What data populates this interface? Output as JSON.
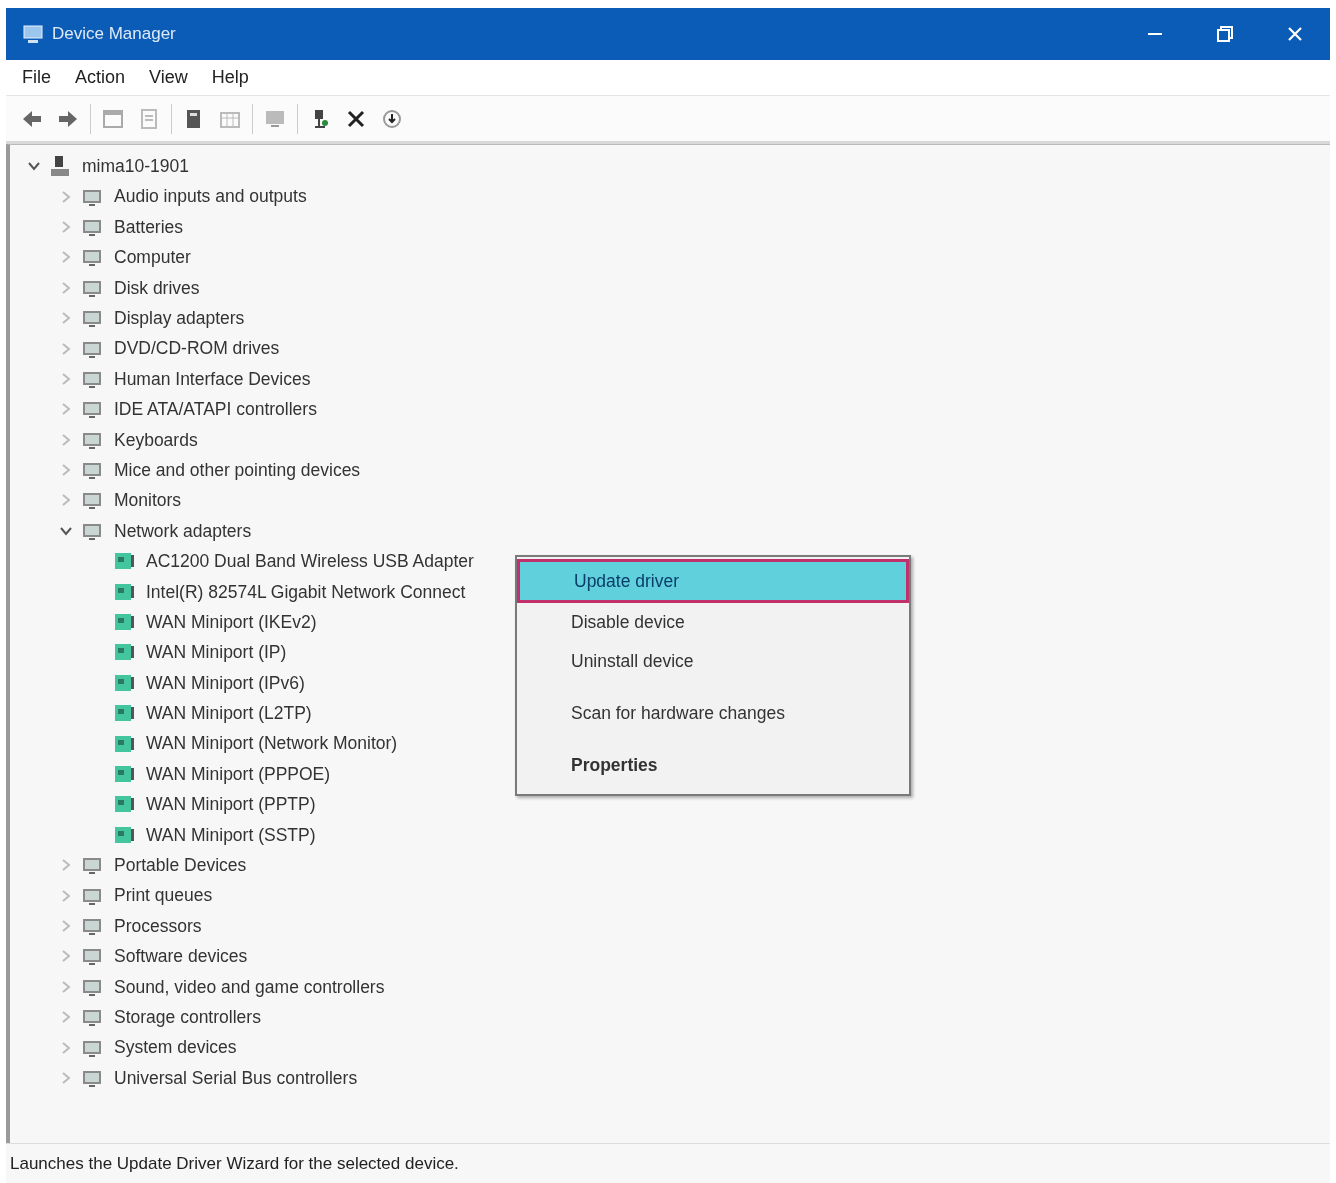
{
  "window": {
    "title": "Device Manager"
  },
  "menu_bar": [
    "File",
    "Action",
    "View",
    "Help"
  ],
  "tree": {
    "label": "mima10-1901",
    "expanded": true,
    "children": [
      {
        "label": "Audio inputs and outputs",
        "expanded": false
      },
      {
        "label": "Batteries",
        "expanded": false
      },
      {
        "label": "Computer",
        "expanded": false
      },
      {
        "label": "Disk drives",
        "expanded": false
      },
      {
        "label": "Display adapters",
        "expanded": false
      },
      {
        "label": "DVD/CD-ROM drives",
        "expanded": false
      },
      {
        "label": "Human Interface Devices",
        "expanded": false
      },
      {
        "label": "IDE ATA/ATAPI controllers",
        "expanded": false
      },
      {
        "label": "Keyboards",
        "expanded": false
      },
      {
        "label": "Mice and other pointing devices",
        "expanded": false
      },
      {
        "label": "Monitors",
        "expanded": false
      },
      {
        "label": "Network adapters",
        "expanded": true,
        "children": [
          {
            "label": "AC1200 Dual Band Wireless USB Adapter"
          },
          {
            "label": "Intel(R) 82574L Gigabit Network Connect"
          },
          {
            "label": "WAN Miniport (IKEv2)"
          },
          {
            "label": "WAN Miniport (IP)"
          },
          {
            "label": "WAN Miniport (IPv6)"
          },
          {
            "label": "WAN Miniport (L2TP)"
          },
          {
            "label": "WAN Miniport (Network Monitor)"
          },
          {
            "label": "WAN Miniport (PPPOE)"
          },
          {
            "label": "WAN Miniport (PPTP)"
          },
          {
            "label": "WAN Miniport (SSTP)"
          }
        ]
      },
      {
        "label": "Portable Devices",
        "expanded": false
      },
      {
        "label": "Print queues",
        "expanded": false
      },
      {
        "label": "Processors",
        "expanded": false
      },
      {
        "label": "Software devices",
        "expanded": false
      },
      {
        "label": "Sound, video and game controllers",
        "expanded": false
      },
      {
        "label": "Storage controllers",
        "expanded": false
      },
      {
        "label": "System devices",
        "expanded": false
      },
      {
        "label": "Universal Serial Bus controllers",
        "expanded": false
      }
    ]
  },
  "context_menu": {
    "groups": [
      [
        {
          "label": "Update driver",
          "selected": true,
          "default": false
        },
        {
          "label": "Disable device",
          "selected": false,
          "default": false
        },
        {
          "label": "Uninstall device",
          "selected": false,
          "default": false
        }
      ],
      [
        {
          "label": "Scan for hardware changes",
          "selected": false,
          "default": false
        }
      ],
      [
        {
          "label": "Properties",
          "selected": false,
          "default": true
        }
      ]
    ]
  },
  "status_bar": "Launches the Update Driver Wizard for the selected device."
}
